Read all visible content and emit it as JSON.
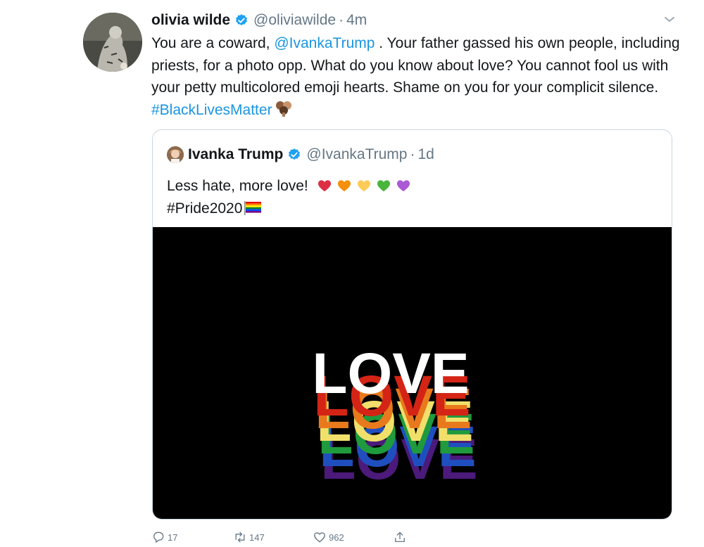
{
  "tweet": {
    "author_name": "olivia wilde",
    "handle": "@oliviawilde",
    "separator": "·",
    "time": "4m",
    "text_1": "You are a coward, ",
    "mention": "@IvankaTrump",
    "text_2": " . Your father gassed his own people, including priests, for a photo opp. What do you know about love? You cannot fool us with your petty multicolored emoji hearts. Shame on you for your complicit silence. ",
    "hashtag": "#BlackLivesMatter"
  },
  "quoted": {
    "author_name": "Ivanka Trump",
    "handle": "@IvankaTrump",
    "separator": "·",
    "time": "1d",
    "text": "Less hate, more love!",
    "hashtag": "#Pride2020",
    "media_text": "LOVE"
  },
  "actions": {
    "reply_count": "17",
    "retweet_count": "147",
    "like_count": "962"
  },
  "colors": {
    "link": "#1b95e0",
    "verified": "#1da1f2",
    "muted": "#657786"
  },
  "icons": [
    "verified-badge-icon",
    "chevron-down-icon",
    "reply-icon",
    "retweet-icon",
    "like-icon",
    "share-icon"
  ]
}
